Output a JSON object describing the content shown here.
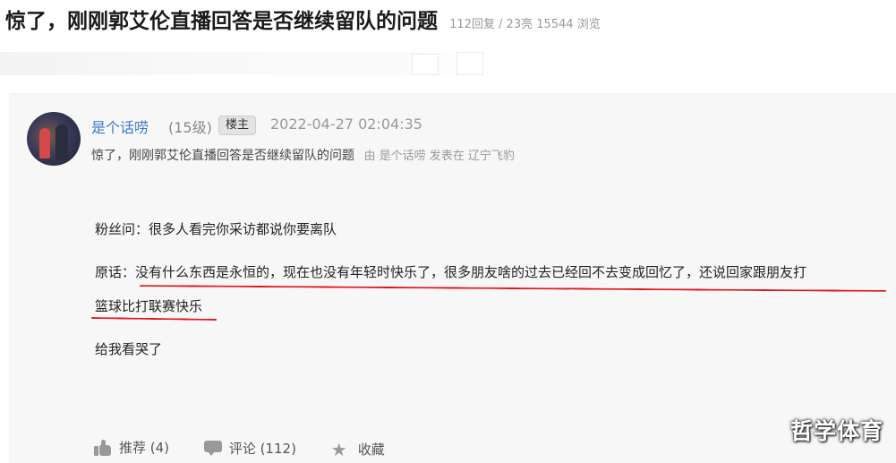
{
  "header": {
    "title": "惊了，刚刚郭艾伦直播回答是否继续留队的问题",
    "meta": "112回复 / 23亮 15544 浏览"
  },
  "post": {
    "username": "是个话唠",
    "level": "(15级)",
    "badge": "楼主",
    "datetime": "2022-04-27 02:04:35",
    "sub_title": "惊了，刚刚郭艾伦直播回答是否继续留队的问题",
    "sub_title_byline": "由 是个话唠 发表在 辽宁飞豹",
    "body": {
      "line1": "粉丝问：很多人看完你采访都说你要离队",
      "line2": "原话：没有什么东西是永恒的，现在也没有年轻时快乐了，很多朋友啥的过去已经回不去变成回忆了，还说回家跟朋友打",
      "line3": "篮球比打联赛快乐",
      "line4": "给我看哭了"
    },
    "underline_color": "#e0151c"
  },
  "actions": {
    "recommend": "推荐 (4)",
    "comment": "评论 (112)",
    "favorite": "收藏"
  },
  "watermark": "哲学体育",
  "colors": {
    "username": "#3d78c9",
    "post_bg": "#f7f7f7"
  }
}
